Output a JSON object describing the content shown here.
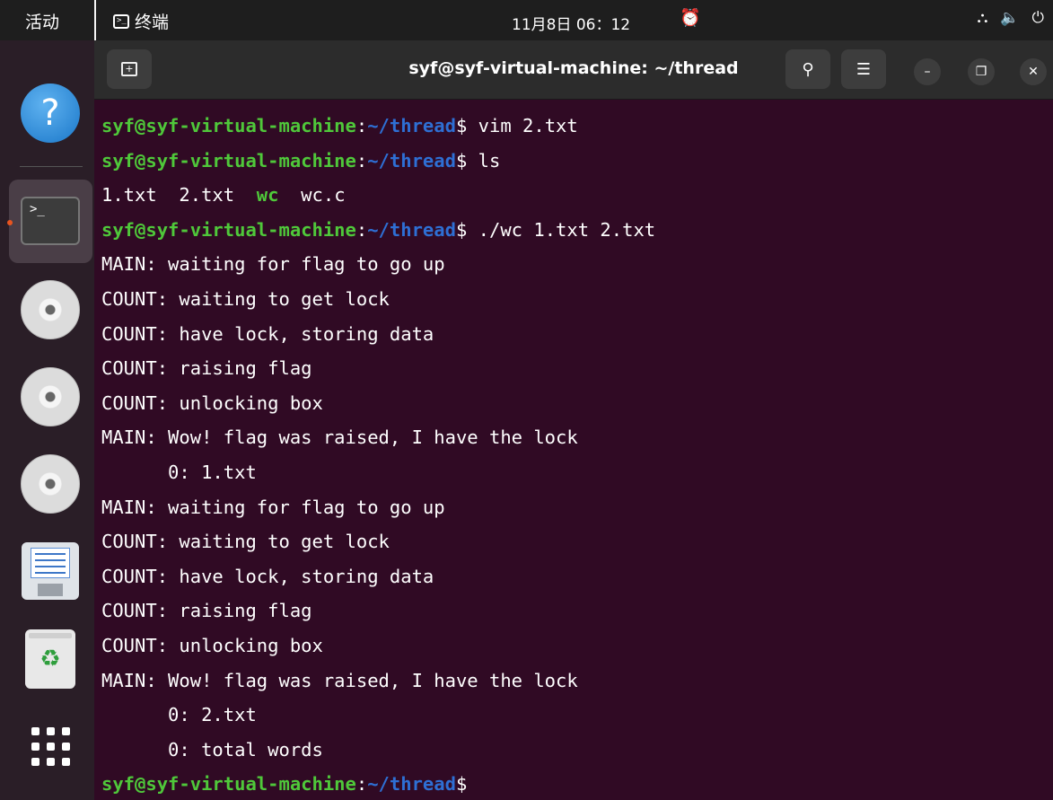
{
  "topbar": {
    "activities": "活动",
    "app_name": "终端",
    "clock": "11月8日  06：12"
  },
  "window": {
    "title": "syf@syf-virtual-machine: ~/thread"
  },
  "prompt": {
    "user_host": "syf@syf-virtual-machine",
    "colon": ":",
    "path": "~/thread",
    "dollar": "$"
  },
  "terminal": {
    "cmd1": " vim 2.txt",
    "cmd2": " ls",
    "ls_a": "1.txt  2.txt  ",
    "ls_b": "wc",
    "ls_c": "  wc.c",
    "cmd3": " ./wc 1.txt 2.txt",
    "out": [
      "MAIN: waiting for flag to go up",
      "COUNT: waiting to get lock",
      "COUNT: have lock, storing data",
      "COUNT: raising flag",
      "COUNT: unlocking box",
      "MAIN: Wow! flag was raised, I have the lock",
      "      0: 1.txt",
      "MAIN: waiting for flag to go up",
      "COUNT: waiting to get lock",
      "COUNT: have lock, storing data",
      "COUNT: raising flag",
      "COUNT: unlocking box",
      "MAIN: Wow! flag was raised, I have the lock",
      "      0: 2.txt",
      "      0: total words"
    ]
  },
  "icons": {
    "help": "help-icon",
    "terminal": "terminal-icon",
    "disc": "disc-icon",
    "text_editor": "text-editor-icon",
    "trash": "trash-icon",
    "apps": "show-apps-icon"
  },
  "colors": {
    "terminal_bg": "#300a24",
    "prompt_user": "#4fc83a",
    "prompt_path": "#2e6fd4",
    "accent": "#e95420"
  }
}
